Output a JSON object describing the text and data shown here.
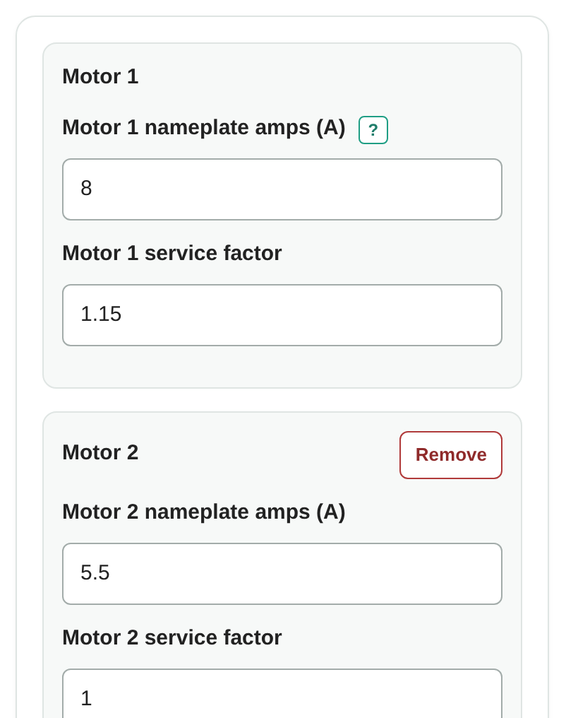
{
  "motors": [
    {
      "title": "Motor 1",
      "fields": [
        {
          "label": "Motor 1 nameplate amps (A)",
          "help": "?",
          "value": "8"
        },
        {
          "label": "Motor 1 service factor",
          "value": "1.15"
        }
      ]
    },
    {
      "title": "Motor 2",
      "remove_button": "Remove",
      "fields": [
        {
          "label": "Motor 2 nameplate amps (A)",
          "value": "5.5"
        },
        {
          "label": "Motor 2 service factor",
          "value": "1"
        }
      ]
    }
  ]
}
